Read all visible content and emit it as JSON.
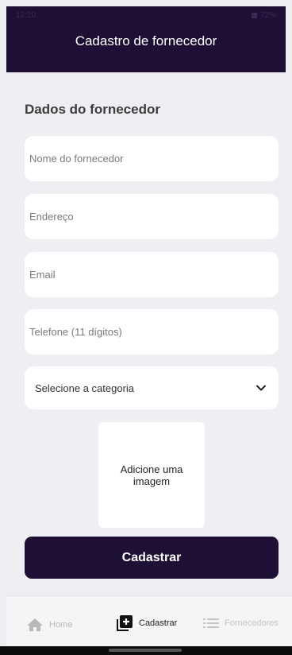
{
  "status_bar": {
    "time": "12:20",
    "battery": "72%"
  },
  "header": {
    "title": "Cadastro de fornecedor"
  },
  "form": {
    "section_title": "Dados do fornecedor",
    "fields": [
      {
        "placeholder": "Nome do fornecedor",
        "value": ""
      },
      {
        "placeholder": "Endereço",
        "value": ""
      },
      {
        "placeholder": "Email",
        "value": ""
      },
      {
        "placeholder": "Telefone (11 dígitos)",
        "value": ""
      }
    ],
    "category_select": {
      "selected": "Selecione a categoria",
      "icon": "chevron-down-icon"
    },
    "image_picker_label": "Adicione uma imagem",
    "submit_label": "Cadastrar"
  },
  "bottom_nav": {
    "items": [
      {
        "label": "Home",
        "icon": "home-icon",
        "active": false
      },
      {
        "label": "Cadastrar",
        "icon": "add-box-icon",
        "active": true
      },
      {
        "label": "Fornecedores",
        "icon": "list-icon",
        "active": false
      }
    ]
  },
  "colors": {
    "primary": "#1e0f35",
    "background": "#efeef2",
    "surface": "#ffffff",
    "nav_inactive": "#b8b8b8"
  }
}
